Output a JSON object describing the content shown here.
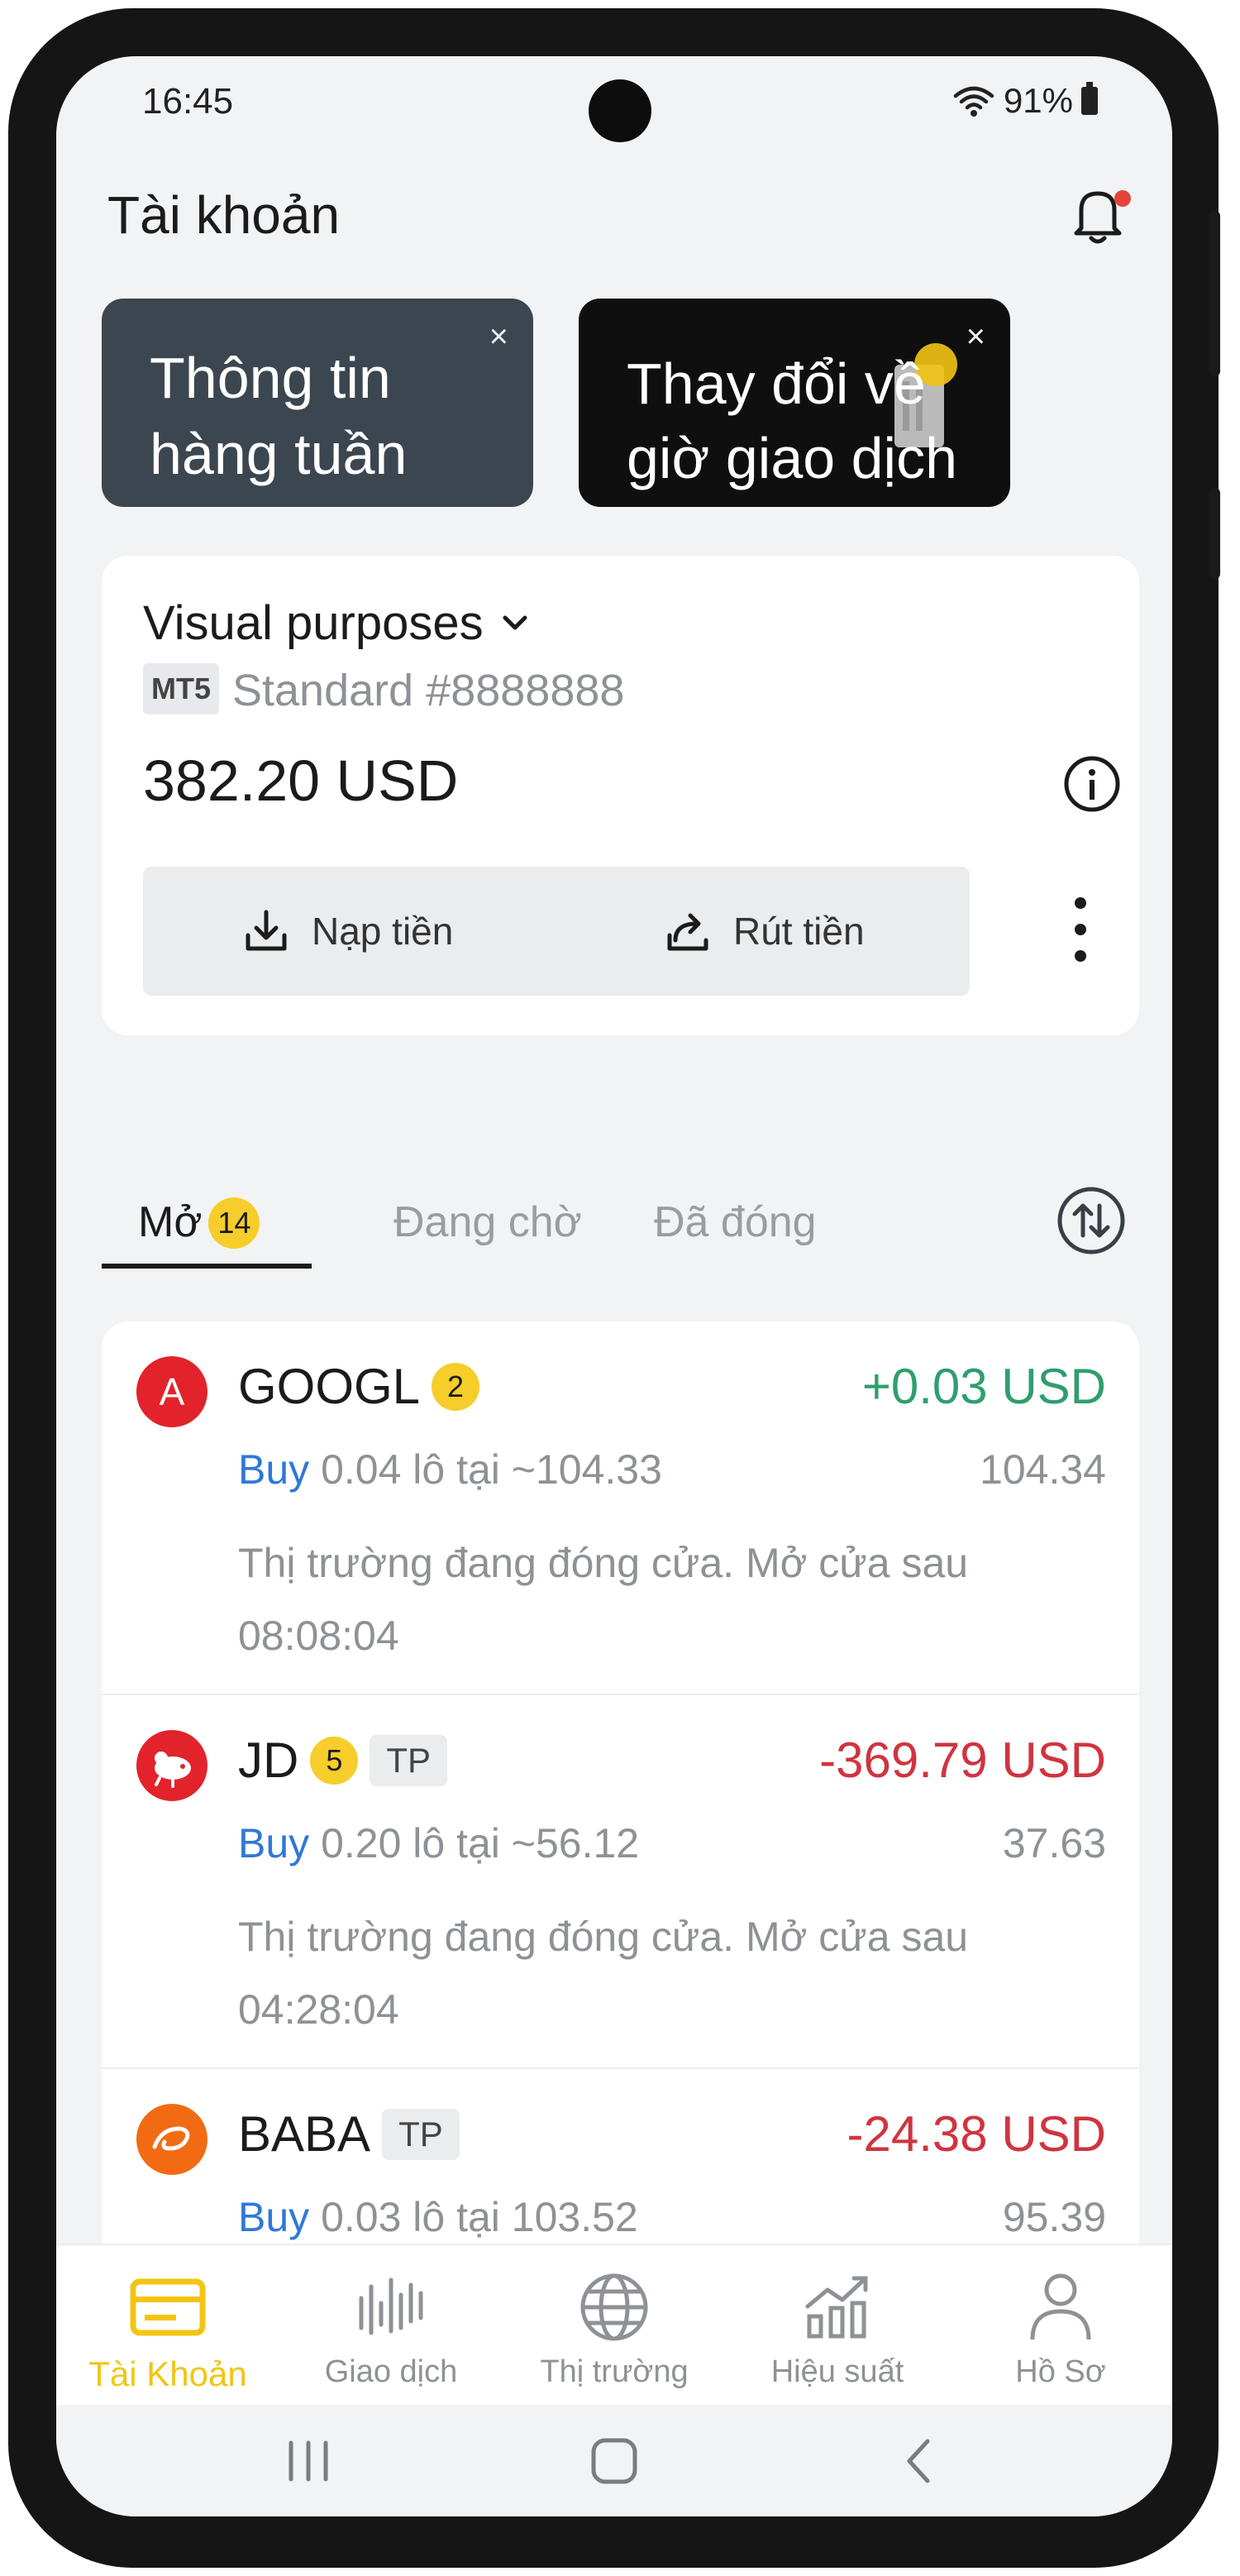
{
  "status_bar": {
    "time": "16:45",
    "battery": "91%"
  },
  "header": {
    "title": "Tài khoản"
  },
  "promos": [
    {
      "text_line1": "Thông tin",
      "text_line2": "hàng tuần",
      "close": "×"
    },
    {
      "text_line1": "Thay đổi về",
      "text_line2": "giờ giao dịch",
      "close": "×"
    }
  ],
  "account": {
    "name": "Visual purposes",
    "platform": "MT5",
    "type": "Standard #8888888",
    "balance": "382.20 USD",
    "deposit_label": "Nạp tiền",
    "withdraw_label": "Rút tiền"
  },
  "tabs": {
    "open_label": "Mở",
    "open_count": "14",
    "pending_label": "Đang chờ",
    "closed_label": "Đã đóng"
  },
  "positions": [
    {
      "symbol": "GOOGL",
      "logo_letter": "A",
      "count": "2",
      "tp": "",
      "pnl": "+0.03 USD",
      "side": "Buy",
      "detail": " 0.04 lô tại ~104.33",
      "current_price": "104.34",
      "message": "Thị trường đang đóng cửa. Mở cửa sau 08:08:04"
    },
    {
      "symbol": "JD",
      "logo_letter": "",
      "count": "5",
      "tp": "TP",
      "pnl": "-369.79 USD",
      "side": "Buy",
      "detail": " 0.20 lô tại ~56.12",
      "current_price": "37.63",
      "message": "Thị trường đang đóng cửa. Mở cửa sau 04:28:04"
    },
    {
      "symbol": "BABA",
      "logo_letter": "",
      "count": "",
      "tp": "TP",
      "pnl": "-24.38 USD",
      "side": "Buy",
      "detail": " 0.03 lô tại 103.52",
      "current_price": "95.39",
      "message": ""
    }
  ],
  "bottom_nav": [
    {
      "label": "Tài Khoản",
      "icon": "wallet-icon",
      "active": true
    },
    {
      "label": "Giao dịch",
      "icon": "candlestick-icon",
      "active": false
    },
    {
      "label": "Thị trường",
      "icon": "globe-icon",
      "active": false
    },
    {
      "label": "Hiệu suất",
      "icon": "performance-chart-icon",
      "active": false
    },
    {
      "label": "Hồ Sơ",
      "icon": "profile-icon",
      "active": false
    }
  ],
  "colors": {
    "accent": "#f3c413",
    "profit": "#2f9e6e",
    "loss": "#d0343f",
    "buy": "#2f78d8"
  }
}
